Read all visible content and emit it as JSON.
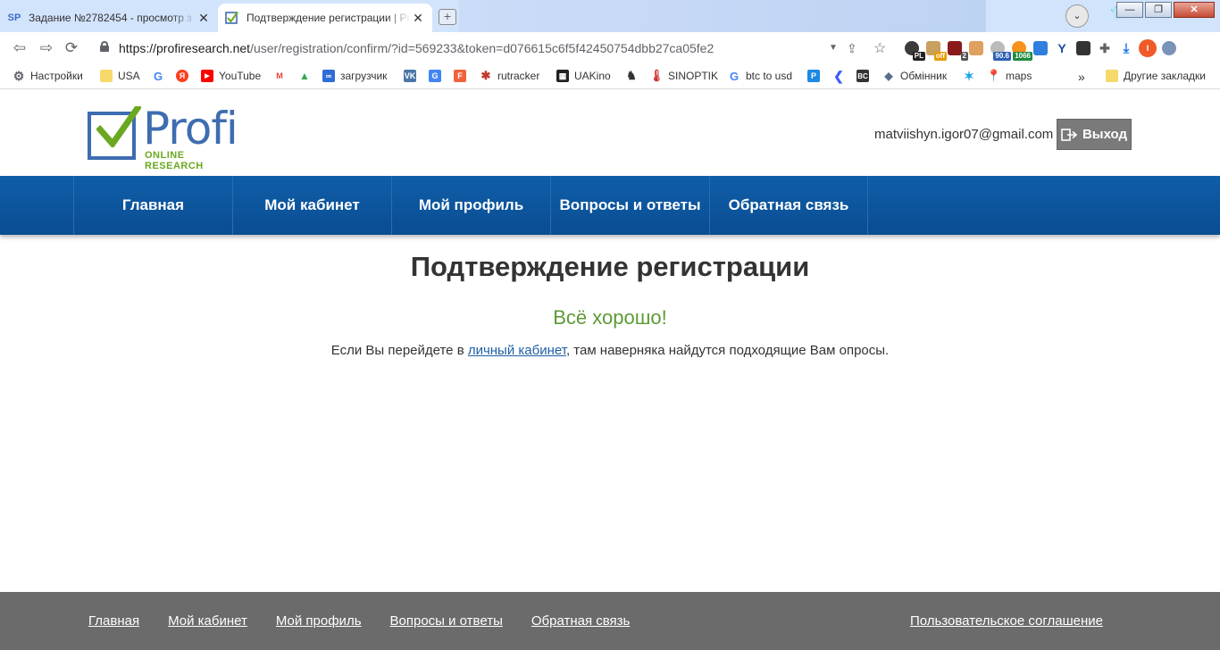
{
  "browser": {
    "tabs": [
      {
        "favicon": "SP",
        "title": "Задание №2782454 - просмотр з",
        "active": false
      },
      {
        "favicon": "checkbox-favicon",
        "title": "Подтверждение регистрации | Pr",
        "active": true
      }
    ],
    "url_host": "https://profiresearch.net",
    "url_path": "/user/registration/confirm/?id=569233&token=d076615c6f5f42450754dbb27ca05fe2",
    "extension_badges": {
      "off": "off",
      "two": "2",
      "score": "90.6",
      "count": "1066"
    },
    "profile_initial": "I",
    "bookmarks": [
      {
        "icon": "gear-icon",
        "label": "Настройки"
      },
      {
        "icon": "folder-icon",
        "label": "USA"
      },
      {
        "icon": "google-icon",
        "label": ""
      },
      {
        "icon": "yandex-icon",
        "label": ""
      },
      {
        "icon": "youtube-icon",
        "label": "YouTube"
      },
      {
        "icon": "gmail-icon",
        "label": ""
      },
      {
        "icon": "drive-icon",
        "label": ""
      },
      {
        "icon": "infinity-icon",
        "label": "загрузчик"
      },
      {
        "icon": "vk-icon",
        "label": ""
      },
      {
        "icon": "translate-icon",
        "label": ""
      },
      {
        "icon": "f-icon",
        "label": ""
      },
      {
        "icon": "rutracker-icon",
        "label": "rutracker"
      },
      {
        "icon": "uakino-icon",
        "label": "UAKino"
      },
      {
        "icon": "chess-icon",
        "label": ""
      },
      {
        "icon": "thermometer-icon",
        "label": "SINOPTIK"
      },
      {
        "icon": "google-icon",
        "label": "btc to usd"
      },
      {
        "icon": "p-icon",
        "label": ""
      },
      {
        "icon": "chevron-icon",
        "label": ""
      },
      {
        "icon": "bc-icon",
        "label": ""
      },
      {
        "icon": "exchange-icon",
        "label": "Обмінник"
      },
      {
        "icon": "kyivstar-icon",
        "label": ""
      },
      {
        "icon": "maps-icon",
        "label": "maps"
      }
    ],
    "more_bookmarks": "»",
    "other_bookmarks": "Другие закладки"
  },
  "site": {
    "logo_word": "Profi",
    "logo_sub": "ONLINE RESEARCH",
    "user_email": "matviishyn.igor07@gmail.com",
    "logout_label": "Выход",
    "nav": [
      "Главная",
      "Мой кабинет",
      "Мой профиль",
      "Вопросы и ответы",
      "Обратная связь"
    ],
    "page_title": "Подтверждение регистрации",
    "success_text": "Всё хорошо!",
    "message_before": "Если Вы перейдете в ",
    "message_link": "личный кабинет",
    "message_after": ", там наверняка найдутся подходящие Вам опросы.",
    "footer_links": [
      "Главная",
      "Мой кабинет",
      "Мой профиль",
      "Вопросы и ответы",
      "Обратная связь"
    ],
    "footer_agreement": "Пользовательское соглашение"
  },
  "colors": {
    "brand_blue": "#3d6db0",
    "brand_green": "#6aa820",
    "nav_blue": "#0a4d93",
    "success_green": "#5d9a36",
    "footer_gray": "#6b6b6b"
  }
}
